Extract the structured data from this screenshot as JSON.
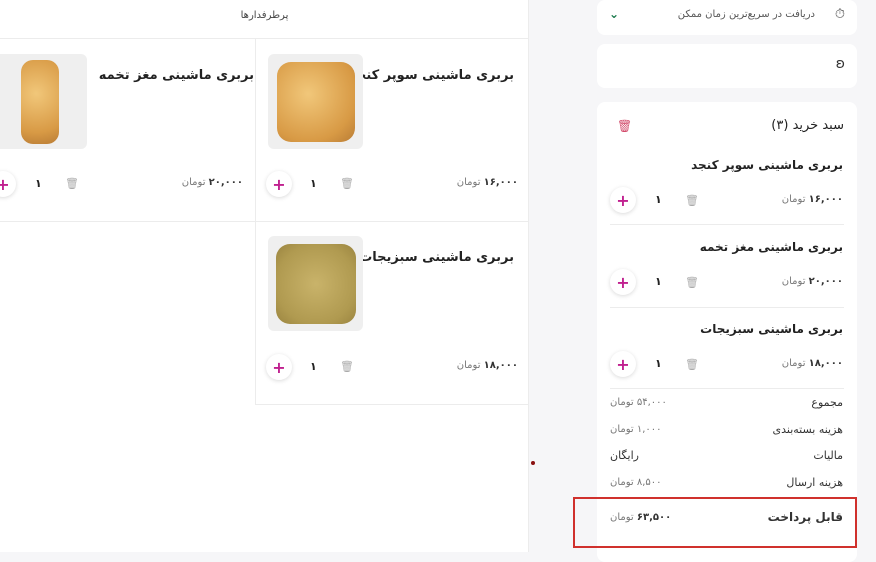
{
  "popular": {
    "title": "پرطرفدارها",
    "products": [
      {
        "name": "بربری ماشینی سوپر کنجد",
        "price": "۱۶,۰۰۰",
        "currency": "تومان",
        "qty": "۱"
      },
      {
        "name": "بربری ماشینی مغز تخمه",
        "price": "۲۰,۰۰۰",
        "currency": "تومان",
        "qty": "۱"
      },
      {
        "name": "بربری ماشینی سبزیجات",
        "price": "۱۸,۰۰۰",
        "currency": "تومان",
        "qty": "۱"
      }
    ]
  },
  "delivery": {
    "label": "دریافت در سریع‌ترین زمان ممکن",
    "icon": "clock-lightning-icon"
  },
  "cart": {
    "title": "سبد خرید (۳)",
    "items": [
      {
        "name": "بربری ماشینی سوپر کنجد",
        "price": "۱۶,۰۰۰",
        "currency": "تومان",
        "qty": "۱"
      },
      {
        "name": "بربری ماشینی مغز تخمه",
        "price": "۲۰,۰۰۰",
        "currency": "تومان",
        "qty": "۱"
      },
      {
        "name": "بربری ماشینی سبزیجات",
        "price": "۱۸,۰۰۰",
        "currency": "تومان",
        "qty": "۱"
      }
    ],
    "summary": [
      {
        "label": "مجموع",
        "value": "۵۴,۰۰۰ تومان"
      },
      {
        "label": "هزینه بسته‌بندی",
        "value": "۱,۰۰۰ تومان"
      },
      {
        "label": "مالیات",
        "value": "رایگان"
      },
      {
        "label": "هزینه ارسال",
        "value": "۸,۵۰۰ تومان"
      }
    ],
    "payable": {
      "label": "قابل پرداخت",
      "amount": "۶۳,۵۰۰",
      "currency": "تومان"
    }
  },
  "colors": {
    "accent": "#c0208f",
    "highlight": "#d0312d",
    "chevron": "#1b7a4c"
  }
}
